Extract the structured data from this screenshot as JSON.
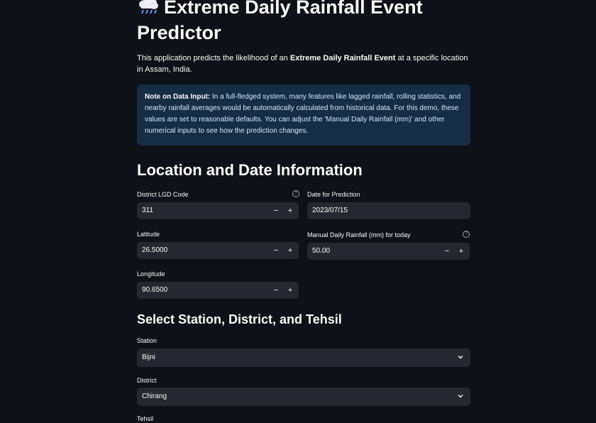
{
  "header": {
    "title": "Extreme Daily Rainfall Event Predictor",
    "emoji_icon": "cloud-rain-icon"
  },
  "intro": {
    "prefix": "This application predicts the likelihood of an ",
    "bold": "Extreme Daily Rainfall Event",
    "suffix": " at a specific location in Assam, India."
  },
  "info": {
    "bold": "Note on Data Input:",
    "text": " In a full-fledged system, many features like lagged rainfall, rolling statistics, and nearby rainfall averages would be automatically calculated from historical data. For this demo, these values are set to reasonable defaults. You can adjust the 'Manual Daily Rainfall (mm)' and other numerical inputs to see how the prediction changes."
  },
  "location_section": {
    "heading": "Location and Date Information",
    "district_lgd": {
      "label": "District LGD Code",
      "value": "311"
    },
    "date": {
      "label": "Date for Prediction",
      "value": "2023/07/15"
    },
    "latitude": {
      "label": "Latitude",
      "value": "26.5000"
    },
    "manual_rainfall": {
      "label": "Manual Daily Rainfall (mm) for today",
      "value": "50.00"
    },
    "longitude": {
      "label": "Longitude",
      "value": "90.6500"
    },
    "minus": "−",
    "plus": "+",
    "help": "?"
  },
  "select_section": {
    "heading": "Select Station, District, and Tehsil",
    "station": {
      "label": "Station",
      "value": "Bijni"
    },
    "district": {
      "label": "District",
      "value": "Chirang"
    },
    "tehsil": {
      "label": "Tehsil"
    }
  },
  "colors": {
    "background": "#0e1117",
    "input": "#262730",
    "info_box": "#172d43"
  }
}
